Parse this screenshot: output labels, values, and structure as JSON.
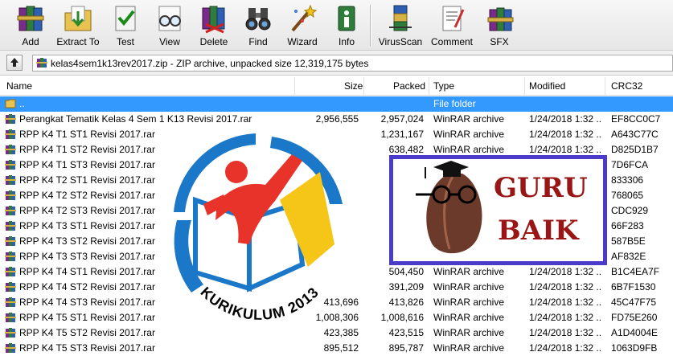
{
  "toolbar": {
    "buttons": [
      {
        "id": "add",
        "label": "Add",
        "icon": "add-books-icon"
      },
      {
        "id": "extract",
        "label": "Extract To",
        "icon": "extract-folder-icon"
      },
      {
        "id": "test",
        "label": "Test",
        "icon": "test-check-icon"
      },
      {
        "id": "view",
        "label": "View",
        "icon": "view-glasses-icon"
      },
      {
        "id": "delete",
        "label": "Delete",
        "icon": "delete-icon"
      },
      {
        "id": "find",
        "label": "Find",
        "icon": "find-binoculars-icon"
      },
      {
        "id": "wizard",
        "label": "Wizard",
        "icon": "wizard-icon"
      },
      {
        "id": "info",
        "label": "Info",
        "icon": "info-icon"
      },
      {
        "id": "virusscan",
        "label": "VirusScan",
        "icon": "virusscan-icon"
      },
      {
        "id": "comment",
        "label": "Comment",
        "icon": "comment-icon"
      },
      {
        "id": "sfx",
        "label": "SFX",
        "icon": "sfx-icon"
      }
    ]
  },
  "address": {
    "path": "kelas4sem1k13rev2017.zip - ZIP archive, unpacked size 12,319,175 bytes"
  },
  "columns": {
    "name": "Name",
    "size": "Size",
    "packed": "Packed",
    "type": "Type",
    "modified": "Modified",
    "crc": "CRC32"
  },
  "files": [
    {
      "name": "..",
      "size": "",
      "packed": "",
      "type": "File folder",
      "modified": "",
      "crc": "",
      "selected": true
    },
    {
      "name": "Perangkat Tematik Kelas 4 Sem 1 K13 Revisi 2017.rar",
      "size": "2,956,555",
      "packed": "2,957,024",
      "type": "WinRAR archive",
      "modified": "1/24/2018 1:32 ...",
      "crc": "EF8CC0C7"
    },
    {
      "name": "RPP K4 T1 ST1 Revisi 2017.rar",
      "size": "",
      "packed": "1,231,167",
      "type": "WinRAR archive",
      "modified": "1/24/2018 1:32 ...",
      "crc": "A643C77C"
    },
    {
      "name": "RPP K4 T1 ST2 Revisi 2017.rar",
      "size": "",
      "packed": "638,482",
      "type": "WinRAR archive",
      "modified": "1/24/2018 1:32 ...",
      "crc": "D825D1B7"
    },
    {
      "name": "RPP K4 T1 ST3 Revisi 2017.rar",
      "size": "",
      "packed": "",
      "type": "WinRAR archive",
      "modified": "1/24/2018 1:32 ...",
      "crc": "7D6FCA"
    },
    {
      "name": "RPP K4 T2 ST1 Revisi 2017.rar",
      "size": "",
      "packed": "",
      "type": "",
      "modified": "",
      "crc": "833306"
    },
    {
      "name": "RPP K4 T2 ST2 Revisi 2017.rar",
      "size": "",
      "packed": "",
      "type": "",
      "modified": "",
      "crc": "768065"
    },
    {
      "name": "RPP K4 T2 ST3 Revisi 2017.rar",
      "size": "",
      "packed": "",
      "type": "",
      "modified": "",
      "crc": "CDC929"
    },
    {
      "name": "RPP K4 T3 ST1 Revisi 2017.rar",
      "size": "",
      "packed": "",
      "type": "",
      "modified": "",
      "crc": "66F283"
    },
    {
      "name": "RPP K4 T3 ST2 Revisi 2017.rar",
      "size": "",
      "packed": "",
      "type": "",
      "modified": "",
      "crc": "587B5E"
    },
    {
      "name": "RPP K4 T3 ST3 Revisi 2017.rar",
      "size": "",
      "packed": "",
      "type": "",
      "modified": "",
      "crc": "AF832E"
    },
    {
      "name": "RPP K4 T4 ST1 Revisi 2017.rar",
      "size": "",
      "packed": "504,450",
      "type": "WinRAR archive",
      "modified": "1/24/2018 1:32 ...",
      "crc": "B1C4EA7F"
    },
    {
      "name": "RPP K4 T4 ST2 Revisi 2017.rar",
      "size": "",
      "packed": "391,209",
      "type": "WinRAR archive",
      "modified": "1/24/2018 1:32 ...",
      "crc": "6B7F1530"
    },
    {
      "name": "RPP K4 T4 ST3 Revisi 2017.rar",
      "size": "413,696",
      "packed": "413,826",
      "type": "WinRAR archive",
      "modified": "1/24/2018 1:32 ...",
      "crc": "45C47F75"
    },
    {
      "name": "RPP K4 T5 ST1 Revisi 2017.rar",
      "size": "1,008,306",
      "packed": "1,008,616",
      "type": "WinRAR archive",
      "modified": "1/24/2018 1:32 ...",
      "crc": "FD75E260"
    },
    {
      "name": "RPP K4 T5 ST2 Revisi 2017.rar",
      "size": "423,385",
      "packed": "423,515",
      "type": "WinRAR archive",
      "modified": "1/24/2018 1:32 ...",
      "crc": "A1D4004E"
    },
    {
      "name": "RPP K4 T5 ST3 Revisi 2017.rar",
      "size": "895,512",
      "packed": "895,787",
      "type": "WinRAR archive",
      "modified": "1/24/2018 1:32 ...",
      "crc": "1063D9FB"
    }
  ],
  "overlays": {
    "k13_logo_text": "KURIKULUM 2013",
    "guru_line1": "GURU",
    "guru_line2": "BAIK"
  },
  "colors": {
    "selection": "#3399ff",
    "k13_red": "#e8332a",
    "k13_blue": "#1b77c8",
    "k13_yellow": "#f5c518",
    "guru_frame": "#4a3cc8",
    "guru_text": "#9a1515"
  }
}
